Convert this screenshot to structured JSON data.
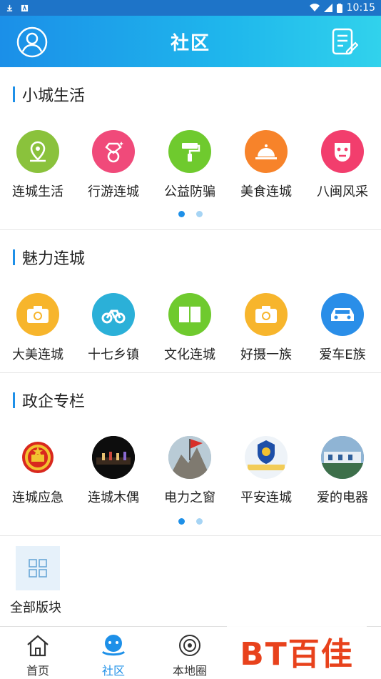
{
  "status_bar": {
    "time": "10:15"
  },
  "header": {
    "title": "社区"
  },
  "sections": [
    {
      "title": "小城生活",
      "items": [
        {
          "label": "连城生活",
          "color": "#8ac23c",
          "icon": "location-pin-icon"
        },
        {
          "label": "行游连城",
          "color": "#f04a7a",
          "icon": "diamond-ring-icon"
        },
        {
          "label": "公益防骗",
          "color": "#6fca2e",
          "icon": "paint-roller-icon"
        },
        {
          "label": "美食连城",
          "color": "#f7832a",
          "icon": "food-cloche-icon"
        },
        {
          "label": "八闽风采",
          "color": "#f23e6d",
          "icon": "face-mask-icon"
        }
      ]
    },
    {
      "title": "魅力连城",
      "items": [
        {
          "label": "大美连城",
          "color": "#f7b52c",
          "icon": "camera-icon"
        },
        {
          "label": "十七乡镇",
          "color": "#2bb0d8",
          "icon": "bicycle-icon"
        },
        {
          "label": "文化连城",
          "color": "#6fca2e",
          "icon": "book-icon"
        },
        {
          "label": "好摄一族",
          "color": "#f7b52c",
          "icon": "camera-icon"
        },
        {
          "label": "爱车E族",
          "color": "#2a8ee8",
          "icon": "car-icon"
        }
      ]
    },
    {
      "title": "政企专栏",
      "items": [
        {
          "label": "连城应急",
          "color": "#ffffff",
          "icon": "national-emblem-icon"
        },
        {
          "label": "连城木偶",
          "color": "#111111",
          "icon": "puppet-stage-photo-icon"
        },
        {
          "label": "电力之窗",
          "color": "#9fb6c4",
          "icon": "power-mountain-photo-icon"
        },
        {
          "label": "平安连城",
          "color": "#ffffff",
          "icon": "police-badge-icon"
        },
        {
          "label": "爱的电器",
          "color": "#5f8cb0",
          "icon": "city-photo-icon"
        }
      ]
    }
  ],
  "all_blocks": {
    "label": "全部版块"
  },
  "bottom_nav": [
    {
      "label": "首页",
      "icon": "home-icon"
    },
    {
      "label": "社区",
      "icon": "community-icon"
    },
    {
      "label": "本地圈",
      "icon": "local-circle-icon"
    },
    {
      "label": "",
      "icon": "nav-icon-4"
    },
    {
      "label": "",
      "icon": "nav-icon-5"
    }
  ],
  "watermark": {
    "text": "BT百佳"
  }
}
